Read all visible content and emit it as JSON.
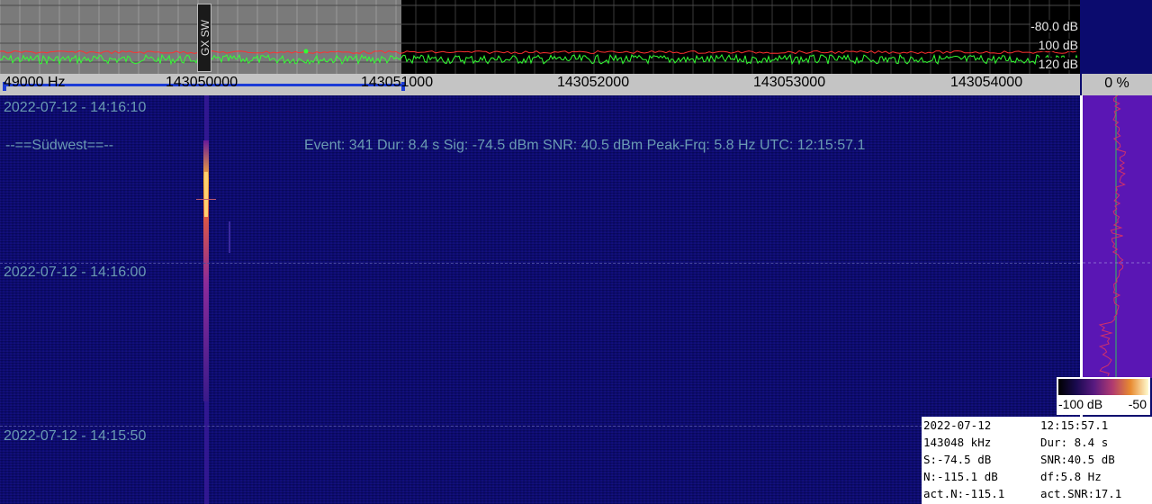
{
  "spectrum": {
    "db_labels": [
      "-80.0 dB",
      "100 dB",
      "120 dB"
    ],
    "marker_label": "GX SW",
    "trace_color": "#33ff33",
    "threshold_color": "#ff3030"
  },
  "freq_axis": {
    "ticks": [
      "49000 Hz",
      "143050000",
      "143051000",
      "143052000",
      "143053000",
      "143054000"
    ]
  },
  "percent": "0 %",
  "waterfall": {
    "timestamps": [
      "2022-07-12 - 14:16:10",
      "2022-07-12 - 14:16:00",
      "2022-07-12 - 14:15:50"
    ],
    "station": "--==Südwest==--",
    "event_info": "Event: 341    Dur: 8.4 s    Sig: -74.5 dBm    SNR: 40.5 dBm    Peak-Frq: 5.8 Hz    UTC: 12:15:57.1"
  },
  "color_scale": {
    "min": "-100 dB",
    "max": "-50"
  },
  "stats": {
    "rows": [
      [
        "2022-07-12",
        "12:15:57.1"
      ],
      [
        "143048 kHz",
        "Dur: 8.4 s"
      ],
      [
        "S:-74.5 dB",
        "SNR:40.5 dB"
      ],
      [
        "N:-115.1 dB",
        "df:5.8 Hz"
      ],
      [
        "act.N:-115.1",
        "act.SNR:17.1"
      ]
    ]
  }
}
